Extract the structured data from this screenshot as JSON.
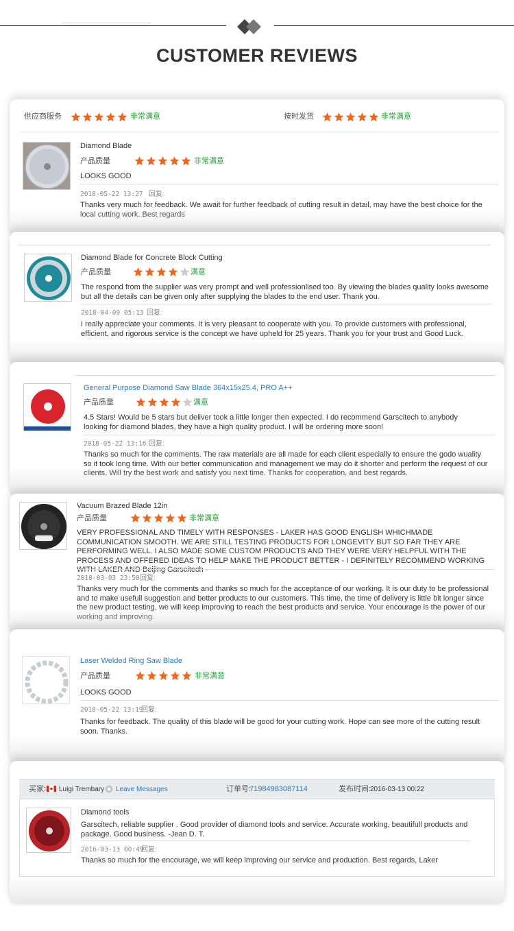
{
  "page": {
    "title": "CUSTOMER REVIEWS"
  },
  "colors": {
    "star_on": "#f0661a",
    "star_off": "#cccccc",
    "green_text": "#25a33a",
    "link": "#2b7bc0"
  },
  "summary": {
    "supplier_service_label": "供应商服务",
    "supplier_service_stars": 5,
    "supplier_service_text": "非常满意",
    "delivery_label": "按时发货",
    "delivery_stars": 5,
    "delivery_text": "非常满意"
  },
  "reviews": [
    {
      "product": "Diamond Blade",
      "quality_label": "产品质量",
      "rating": 5,
      "rating_text": "非常满意",
      "comment": "LOOKS GOOD",
      "date": "2018-05-22 13:27",
      "reply_label": "回复:",
      "reply": "Thanks very much for feedback. We await for further feedback of cutting result in detail, may have the best choice for the local cutting work. Best regards"
    },
    {
      "product": "Diamond Blade for Concrete Block Cutting",
      "quality_label": "产品质量",
      "rating": 4,
      "rating_text": "满意",
      "comment": "The respond from the supplier was very prompt and well professionlised too. By viewing the blades quality looks awesome but all the details can be given only after supplying the blades to the end user. Thank you.",
      "date": "2018-04-09 05:13",
      "reply_label": "回复:",
      "reply": "I really appreciate your comments. It is very pleasant to cooperate with you. To provide customers with professional, efficient, and rigorous service is the concept we have upheld for 25 years. Thank you for your trust and Good Luck."
    },
    {
      "product": "General Purpose Diamond Saw Blade 364x15x25.4, PRO A++",
      "quality_label": "产品质量",
      "rating": 4,
      "rating_text": "满意",
      "comment": "4.5 Stars! Would be 5 stars but deliver took a little longer then expected. I do recommend Garscitech to anybody looking for diamond blades, they have a high quality product. I will be ordering more soon!",
      "date": "2018-05-22 13:16",
      "reply_label": "回复:",
      "reply": "Thanks so much for the comments. The raw materials are all made for each client especially to ensure the godo wuality so it took long time. With our better communication and management we may do it shorter and perform the request of our clients. Will try the best work and satisfy you next time. Thanks for cooperation, and best regards."
    },
    {
      "product": "Vacuum Brazed Blade 12in",
      "quality_label": "产品质量",
      "rating": 5,
      "rating_text": "非常满意",
      "comment": "VERY PROFESSIONAL AND TIMELY WITH RESPONSES - LAKER HAS GOOD ENGLISH WHICHMADE COMMUNICATION SMOOTH. WE ARE STILL TESTING PRODUCTS FOR LONGEVITY BUT SO FAR THEY ARE PERFORMING WELL. I ALSO MADE SOME CUSTOM PRODUCTS AND THEY WERE VERY HELPFUL WITH THE PROCESS AND OFFERED IDEAS TO HELP MAKE THE PRODUCT BETTER - I DEFINITELY RECOMMEND WORKING WITH LAKER AND Beijing Garscitech -",
      "date": "2018-03-03 23:50",
      "reply_label": "回复:",
      "reply": "Thanks very much for the comments and thanks so much for the acceptance of our working. It is our duty to be professional and to make usefull suggestion and better products to our customers. This time, the time of delivery is little bit longer since the new product testing, we will keep improving to reach the best products and service. Your encourage is the power of our working and improving."
    },
    {
      "product": "Laser Welded Ring Saw Blade",
      "quality_label": "产品质量",
      "rating": 5,
      "rating_text": "非常满意",
      "comment": "LOOKS GOOD",
      "date": "2018-05-22 13:19",
      "reply_label": "回复:",
      "reply": "Thanks for feedback. The quality of this blade will be good for your cutting work. Hope can see more of the cutting result soon. Thanks."
    }
  ],
  "order_review": {
    "buyer_label": "买家:",
    "buyer_name": "Luigi Trembary",
    "leave_messages": "Leave Messages",
    "order_label": "订单号:",
    "order_number": "71984983087114",
    "published_label": "发布时间:",
    "published_date": "2016-03-13 00:22",
    "product": "Diamond tools",
    "comment": "Garscitech, reliable supplier . Good provider of diamond tools and service. Accurate working, beautifull products and package. Good business. -Jean D. T.",
    "date": "2016-03-13 00:49",
    "reply_label": "回复:",
    "reply": "Thanks so much for the encourage, we will keep improving our service and production. Best regards, Laker"
  }
}
